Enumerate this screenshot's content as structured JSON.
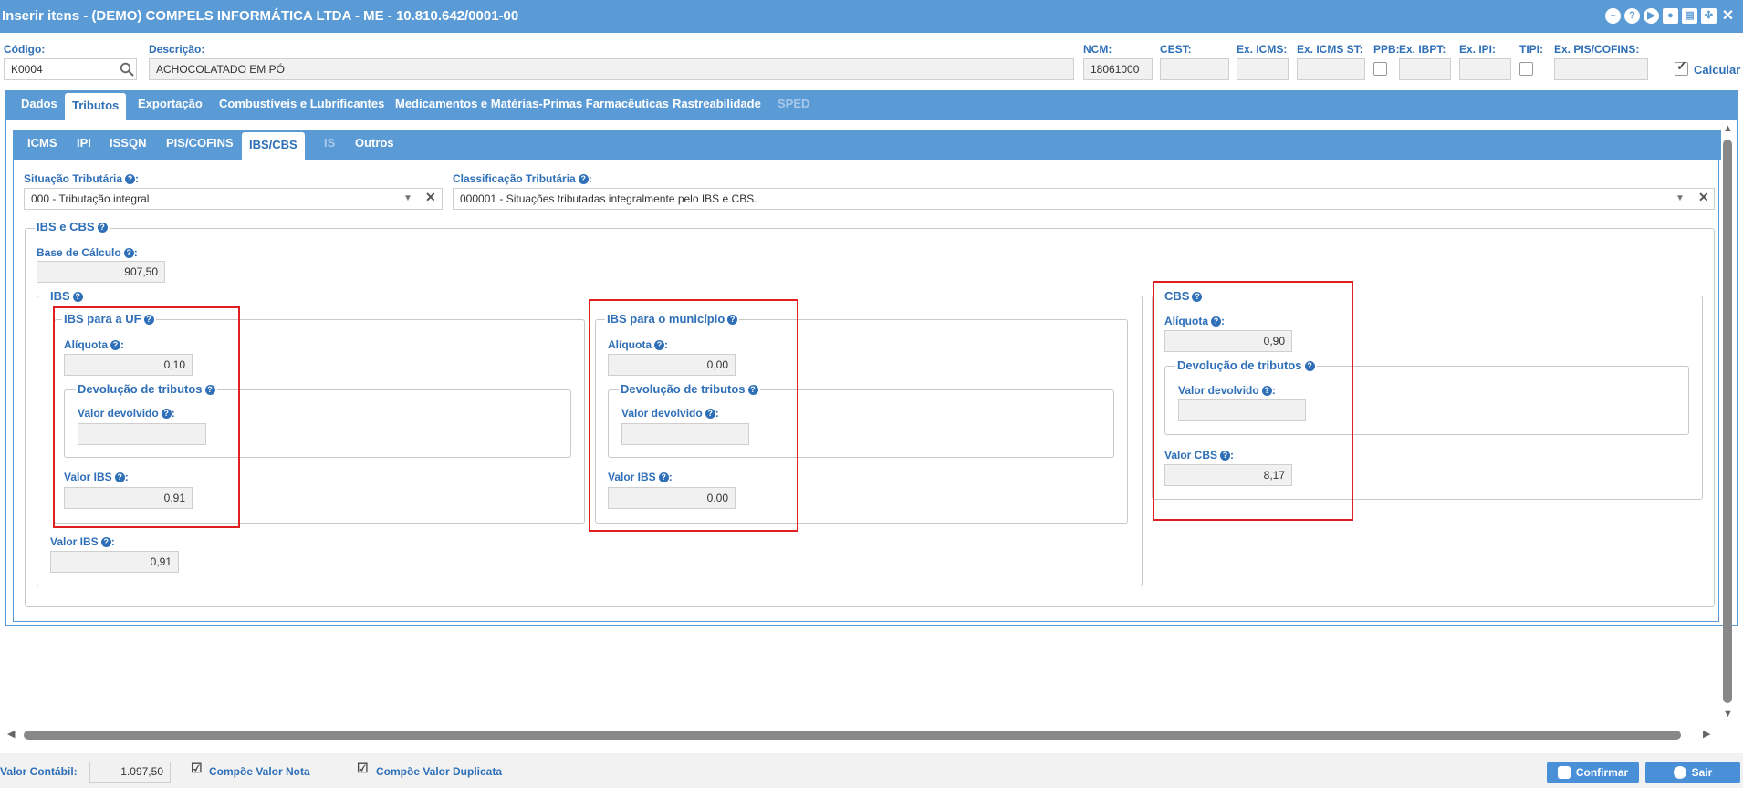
{
  "window": {
    "title": "Inserir itens - (DEMO) COMPELS INFORMÁTICA LTDA - ME - 10.810.642/0001-00",
    "icons": [
      "minimize-icon",
      "help-icon",
      "play-icon",
      "user-icon",
      "printer-icon",
      "compress-icon",
      "close-icon"
    ]
  },
  "header": {
    "codigo": {
      "label": "Código:",
      "value": "K0004"
    },
    "descricao": {
      "label": "Descrição:",
      "value": "ACHOCOLATADO EM PÓ"
    },
    "ncm": {
      "label": "NCM:",
      "value": "18061000"
    },
    "cest": {
      "label": "CEST:",
      "value": ""
    },
    "ex_icms": {
      "label": "Ex. ICMS:",
      "value": ""
    },
    "ex_icms_st": {
      "label": "Ex. ICMS ST:",
      "value": ""
    },
    "ppb": {
      "label": "PPB:"
    },
    "ex_ibpt": {
      "label": "Ex. IBPT:",
      "value": ""
    },
    "ex_ipi": {
      "label": "Ex. IPI:",
      "value": ""
    },
    "tipi": {
      "label": "TIPI:"
    },
    "ex_pis_cofins": {
      "label": "Ex. PIS/COFINS:",
      "value": ""
    },
    "calcular": {
      "label": "Calcular",
      "checked": true
    }
  },
  "tabs_main": [
    {
      "label": "Dados"
    },
    {
      "label": "Tributos",
      "active": true
    },
    {
      "label": "Exportação"
    },
    {
      "label": "Combustíveis e Lubrificantes"
    },
    {
      "label": "Medicamentos e Matérias-Primas Farmacêuticas"
    },
    {
      "label": "Rastreabilidade"
    },
    {
      "label": "SPED",
      "disabled": true
    }
  ],
  "tabs_sub": [
    {
      "label": "ICMS"
    },
    {
      "label": "IPI"
    },
    {
      "label": "ISSQN"
    },
    {
      "label": "PIS/COFINS"
    },
    {
      "label": "IBS/CBS",
      "active": true
    },
    {
      "label": "IS",
      "disabled": true
    },
    {
      "label": "Outros"
    }
  ],
  "situacao": {
    "label": "Situação Tributária",
    "value": "000 - Tributação integral"
  },
  "classificacao": {
    "label": "Classificação Tributária",
    "value": "000001 - Situações tributadas integralmente pelo IBS e CBS."
  },
  "ibs_cbs": {
    "legend": "IBS e CBS",
    "base_calculo": {
      "label": "Base de Cálculo",
      "value": "907,50"
    },
    "ibs": {
      "legend": "IBS",
      "uf": {
        "legend": "IBS para a UF",
        "aliquota_label": "Alíquota",
        "aliquota": "0,10",
        "devolucao_legend": "Devolução de tributos",
        "valor_devolvido_label": "Valor devolvido",
        "valor_devolvido": "",
        "valor_ibs_label": "Valor IBS",
        "valor_ibs": "0,91"
      },
      "municipio": {
        "legend": "IBS para o município",
        "aliquota_label": "Alíquota",
        "aliquota": "0,00",
        "devolucao_legend": "Devolução de tributos",
        "valor_devolvido_label": "Valor devolvido",
        "valor_devolvido": "",
        "valor_ibs_label": "Valor IBS",
        "valor_ibs": "0,00"
      },
      "valor_ibs_label": "Valor IBS",
      "valor_ibs": "0,91"
    },
    "cbs": {
      "legend": "CBS",
      "aliquota_label": "Alíquota",
      "aliquota": "0,90",
      "devolucao_legend": "Devolução de tributos",
      "valor_devolvido_label": "Valor devolvido",
      "valor_devolvido": "",
      "valor_cbs_label": "Valor CBS",
      "valor_cbs": "8,17"
    }
  },
  "footer": {
    "valor_contabil_label": "Valor Contábil:",
    "valor_contabil": "1.097,50",
    "compoe_nota": "Compõe Valor Nota",
    "compoe_duplicata": "Compõe Valor Duplicata",
    "confirmar": "Confirmar",
    "sair": "Sair"
  },
  "colors": {
    "accent": "#5b9bd5",
    "label": "#2e6fb7",
    "highlight": "#e02020"
  }
}
